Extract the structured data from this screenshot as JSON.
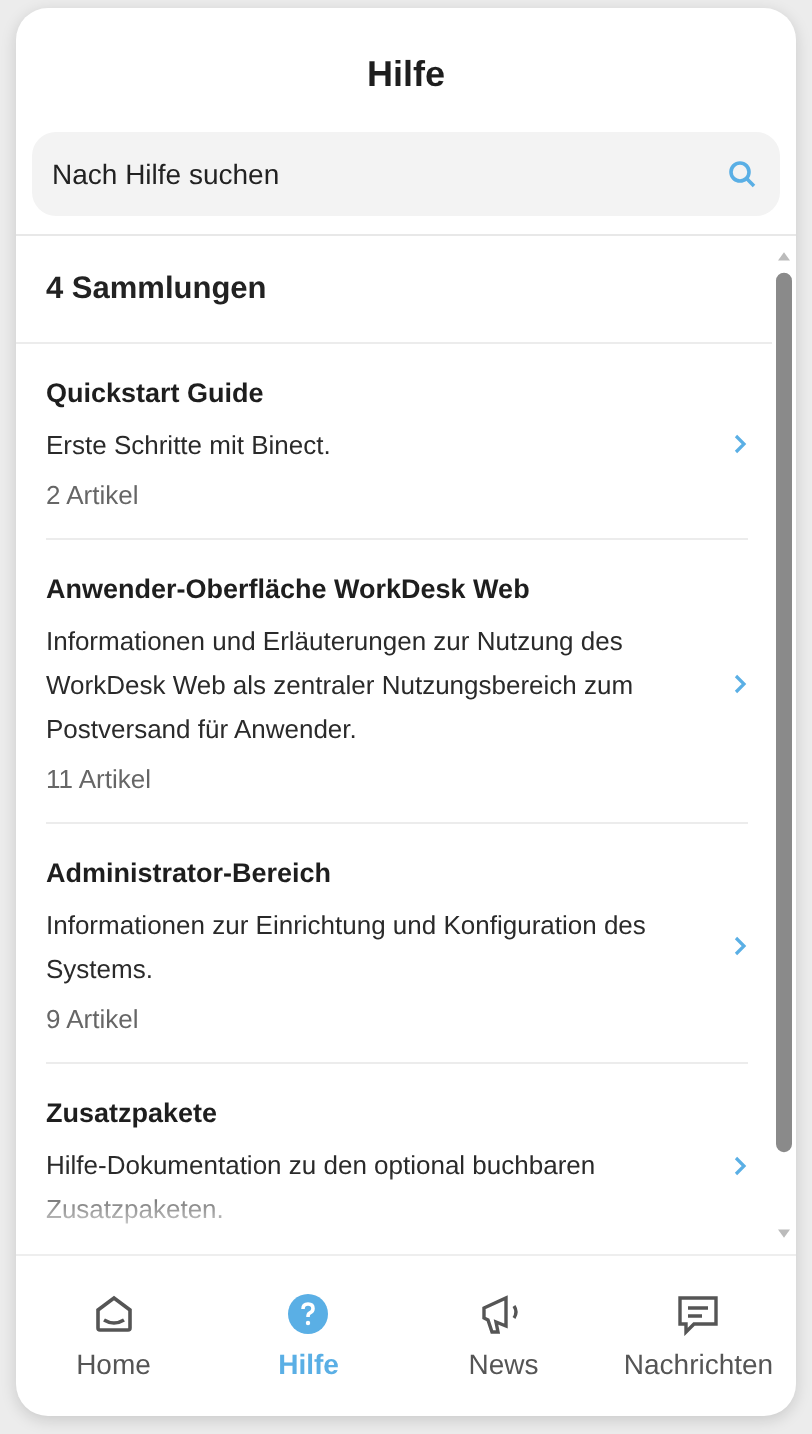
{
  "title": "Hilfe",
  "search": {
    "placeholder": "Nach Hilfe suchen"
  },
  "collections_heading": "4 Sammlungen",
  "collections": [
    {
      "title": "Quickstart Guide",
      "description": "Erste Schritte mit Binect.",
      "count": "2 Artikel"
    },
    {
      "title": "Anwender-Oberfläche WorkDesk Web",
      "description": "Informationen und Erläuterungen zur Nutzung des WorkDesk Web als zentraler Nutzungsbereich zum Postversand für Anwender.",
      "count": "11 Artikel"
    },
    {
      "title": "Administrator-Bereich",
      "description": "Informationen zur Einrichtung und Konfiguration des Systems.",
      "count": "9 Artikel"
    },
    {
      "title": "Zusatzpakete",
      "description": "Hilfe-Dokumentation zu den optional buchbaren Zusatzpaketen."
    }
  ],
  "nav": [
    {
      "label": "Home",
      "selected": false
    },
    {
      "label": "Hilfe",
      "selected": true
    },
    {
      "label": "News",
      "selected": false
    },
    {
      "label": "Nachrichten",
      "selected": false
    }
  ]
}
